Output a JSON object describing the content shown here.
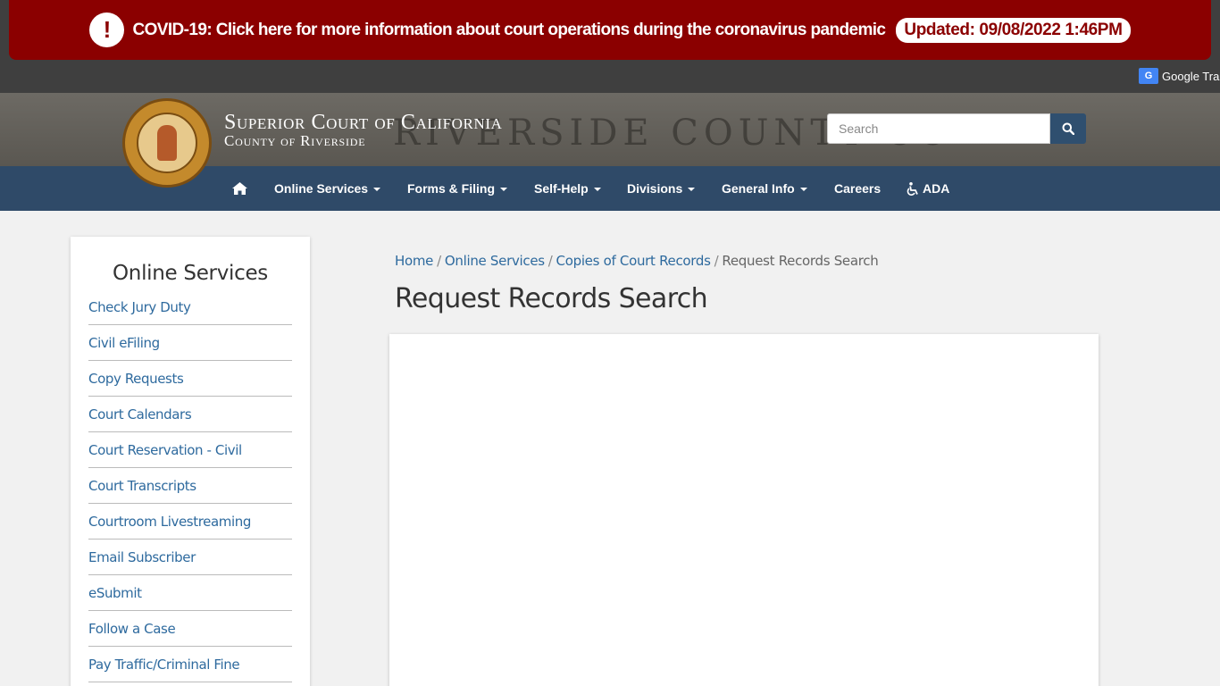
{
  "alert": {
    "icon": "exclamation-icon",
    "message": "COVID-19: Click here for more information about court operations during the coronavirus pandemic",
    "updated": "Updated: 09/08/2022 1:46PM",
    "color": "#8b0000"
  },
  "translate": {
    "label": "Google Tra",
    "icon": "google-translate-icon"
  },
  "header": {
    "title_line1": "Superior Court of California",
    "title_line2": "County of Riverside",
    "background_engraving": "RIVERSIDE COUNTY CO",
    "seal_text": "Superior Court of California · County of Riverside · Eureka"
  },
  "search": {
    "placeholder": "Search",
    "icon": "search-icon"
  },
  "nav": {
    "home_icon": "home-icon",
    "items": [
      {
        "label": "Online Services",
        "dropdown": true
      },
      {
        "label": "Forms & Filing",
        "dropdown": true
      },
      {
        "label": "Self-Help",
        "dropdown": true
      },
      {
        "label": "Divisions",
        "dropdown": true
      },
      {
        "label": "General Info",
        "dropdown": true
      },
      {
        "label": "Careers",
        "dropdown": false
      },
      {
        "label": "ADA",
        "dropdown": false,
        "icon": "wheelchair-icon"
      }
    ],
    "color": "#2f4a68"
  },
  "sidebar": {
    "title": "Online Services",
    "items": [
      "Check Jury Duty",
      "Civil eFiling",
      "Copy Requests",
      "Court Calendars",
      "Court Reservation - Civil",
      "Court Transcripts",
      "Courtroom Livestreaming",
      "Email Subscriber",
      "eSubmit",
      "Follow a Case",
      "Pay Traffic/Criminal Fine"
    ]
  },
  "breadcrumb": {
    "links": [
      "Home",
      "Online Services",
      "Copies of Court Records"
    ],
    "current": "Request Records Search"
  },
  "page": {
    "title": "Request Records Search"
  }
}
